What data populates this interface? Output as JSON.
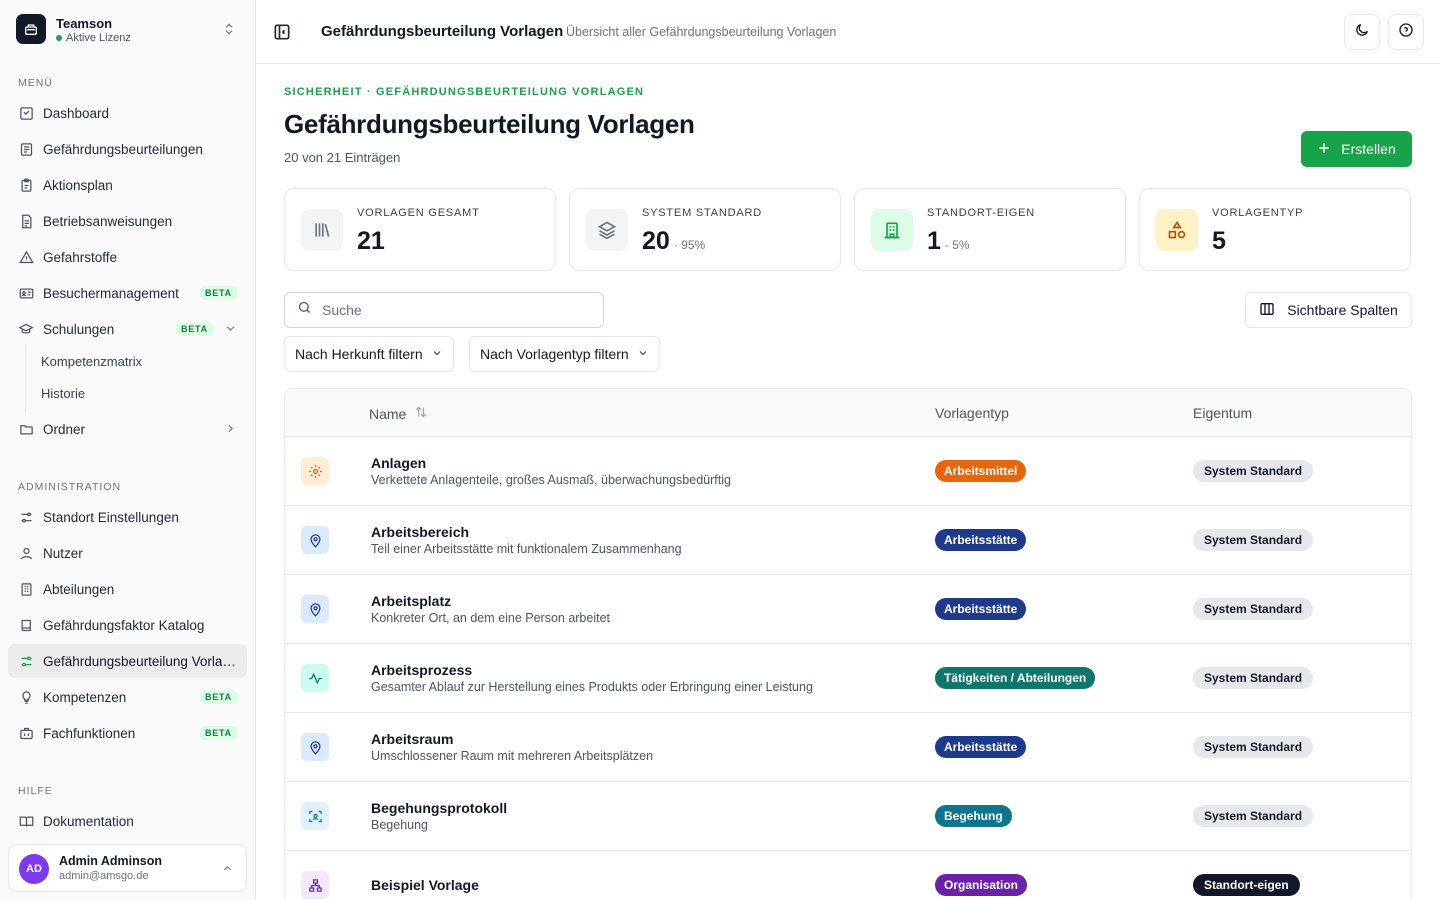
{
  "org": {
    "name": "Teamson",
    "status": "Aktive Lizenz"
  },
  "sidebar": {
    "menu_label": "MENÜ",
    "menu": [
      {
        "label": "Dashboard",
        "icon": "dashboard-icon"
      },
      {
        "label": "Gefährdungsbeurteilungen",
        "icon": "document-list-icon"
      },
      {
        "label": "Aktionsplan",
        "icon": "clipboard-icon"
      },
      {
        "label": "Betriebsanweisungen",
        "icon": "file-text-icon"
      },
      {
        "label": "Gefahrstoffe",
        "icon": "warning-triangle-icon"
      },
      {
        "label": "Besuchermanagement",
        "icon": "id-card-icon",
        "badge": "BETA"
      },
      {
        "label": "Schulungen",
        "icon": "graduation-cap-icon",
        "badge": "BETA"
      }
    ],
    "schulungen_sub": [
      {
        "label": "Kompetenzmatrix"
      },
      {
        "label": "Historie"
      }
    ],
    "ordner": {
      "label": "Ordner"
    },
    "admin_label": "ADMINISTRATION",
    "admin": [
      {
        "label": "Standort Einstellungen",
        "icon": "sliders-icon"
      },
      {
        "label": "Nutzer",
        "icon": "user-icon"
      },
      {
        "label": "Abteilungen",
        "icon": "building-icon"
      },
      {
        "label": "Gefährdungsfaktor Katalog",
        "icon": "book-icon"
      },
      {
        "label": "Gefährdungsbeurteilung Vorlagen",
        "icon": "template-icon",
        "active": true
      },
      {
        "label": "Kompetenzen",
        "icon": "lightbulb-icon",
        "badge": "BETA"
      },
      {
        "label": "Fachfunktionen",
        "icon": "briefcase-icon",
        "badge": "BETA"
      }
    ],
    "help_label": "HILFE",
    "help": [
      {
        "label": "Dokumentation",
        "icon": "open-book-icon"
      }
    ]
  },
  "user": {
    "initials": "AD",
    "name": "Admin Adminson",
    "email": "admin@amsgo.de"
  },
  "header": {
    "title": "Gefährdungsbeurteilung Vorlagen",
    "subtitle": "Übersicht aller Gefährdungsbeurteilung Vorlagen"
  },
  "page": {
    "breadcrumb": "SICHERHEIT · GEFÄHRDUNGSBEURTEILUNG VORLAGEN",
    "title": "Gefährdungsbeurteilung Vorlagen",
    "count": "20 von 21 Einträgen",
    "create_label": "Erstellen"
  },
  "stats": [
    {
      "label": "VORLAGEN GESAMT",
      "value": "21",
      "pct": "",
      "icon": "library-icon",
      "color": "#f3f4f6"
    },
    {
      "label": "SYSTEM STANDARD",
      "value": "20",
      "pct": "· 95%",
      "icon": "layers-icon",
      "color": "#f3f4f6"
    },
    {
      "label": "STANDORT-EIGEN",
      "value": "1",
      "pct": "· 5%",
      "icon": "building-icon",
      "color": "#dcfce7"
    },
    {
      "label": "VORLAGENTYP",
      "value": "5",
      "pct": "",
      "icon": "shapes-icon",
      "color": "#fef3c7"
    }
  ],
  "toolbar": {
    "search_placeholder": "Suche",
    "columns_label": "Sichtbare Spalten",
    "filter_origin": "Nach Herkunft filtern",
    "filter_type": "Nach Vorlagentyp filtern"
  },
  "table": {
    "columns": [
      "Name",
      "Vorlagentyp",
      "Eigentum"
    ],
    "rows": [
      {
        "name": "Anlagen",
        "desc": "Verkettete Anlagenteile, großes Ausmaß, überwachungsbedürftig",
        "type": "Arbeitsmittel",
        "type_color": "#e8650c",
        "owner": "System Standard",
        "icon": "gear-icon",
        "icon_bg": "#ffedd5",
        "icon_fg": "#ea580c"
      },
      {
        "name": "Arbeitsbereich",
        "desc": "Teil einer Arbeitsstätte mit funktionalem Zusammenhang",
        "type": "Arbeitsstätte",
        "type_color": "#1e3a8a",
        "owner": "System Standard",
        "icon": "location-pin-icon",
        "icon_bg": "#dbeafe",
        "icon_fg": "#1e3a8a"
      },
      {
        "name": "Arbeitsplatz",
        "desc": "Konkreter Ort, an dem eine Person arbeitet",
        "type": "Arbeitsstätte",
        "type_color": "#1e3a8a",
        "owner": "System Standard",
        "icon": "location-pin-icon",
        "icon_bg": "#dbeafe",
        "icon_fg": "#1e3a8a"
      },
      {
        "name": "Arbeitsprozess",
        "desc": "Gesamter Ablauf zur Herstellung eines Produkts oder Erbringung einer Leistung",
        "type": "Tätigkeiten / Abteilungen",
        "type_color": "#0f766e",
        "owner": "System Standard",
        "icon": "activity-icon",
        "icon_bg": "#ccfbf1",
        "icon_fg": "#0f766e"
      },
      {
        "name": "Arbeitsraum",
        "desc": "Umschlossener Raum mit mehreren Arbeitsplätzen",
        "type": "Arbeitsstätte",
        "type_color": "#1e3a8a",
        "owner": "System Standard",
        "icon": "location-pin-icon",
        "icon_bg": "#dbeafe",
        "icon_fg": "#1e3a8a"
      },
      {
        "name": "Begehungsprotokoll",
        "desc": "Begehung",
        "type": "Begehung",
        "type_color": "#0e7490",
        "owner": "System Standard",
        "icon": "scan-icon",
        "icon_bg": "#e0f2fe",
        "icon_fg": "#0e7490"
      },
      {
        "name": "Beispiel Vorlage",
        "desc": "",
        "type": "Organisation",
        "type_color": "#6b21a8",
        "owner": "Standort-eigen",
        "icon": "org-chart-icon",
        "icon_bg": "#f3e8ff",
        "icon_fg": "#6b21a8"
      }
    ]
  },
  "colors": {
    "accent": "#16a34a",
    "owner_system_bg": "#e5e7eb",
    "owner_local_bg": "#111827"
  }
}
